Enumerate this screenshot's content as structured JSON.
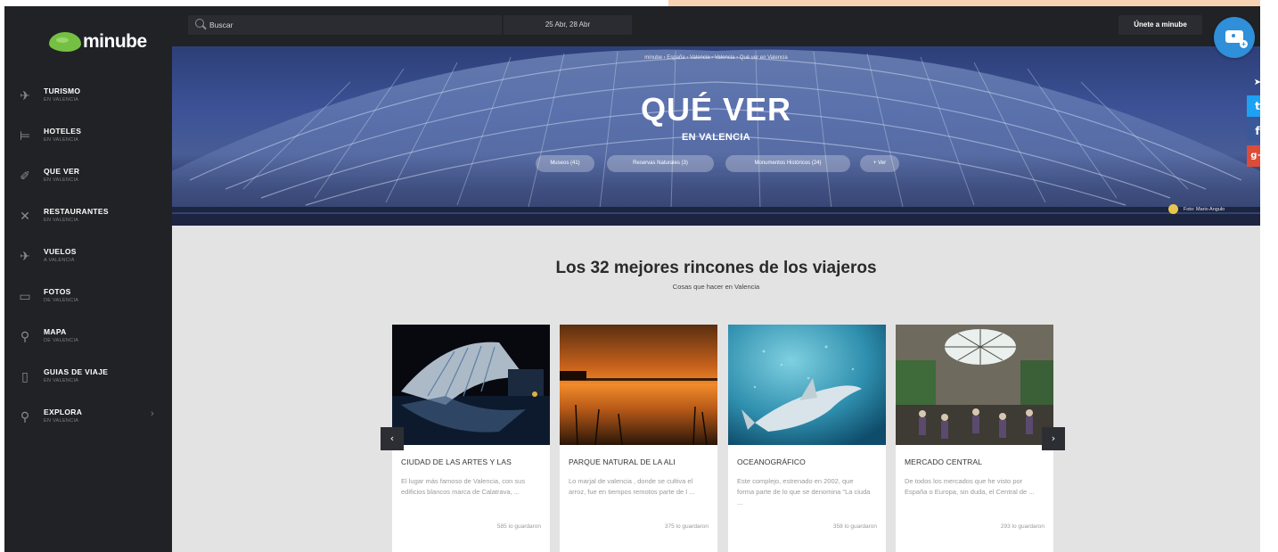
{
  "brand": {
    "logo_text": "minube"
  },
  "topbar": {
    "search_placeholder": "Buscar",
    "dates": "25 Abr, 28 Abr",
    "join_label": "Únete a minube"
  },
  "sidebar": {
    "items": [
      {
        "label": "TURISMO",
        "sub": "EN VALENCIA",
        "icon": "plane-icon"
      },
      {
        "label": "HOTELES",
        "sub": "EN VALENCIA",
        "icon": "bed-icon"
      },
      {
        "label": "QUE VER",
        "sub": "EN VALENCIA",
        "icon": "pin-icon"
      },
      {
        "label": "RESTAURANTES",
        "sub": "EN VALENCIA",
        "icon": "cutlery-icon"
      },
      {
        "label": "VUELOS",
        "sub": "A VALENCIA",
        "icon": "flight-icon"
      },
      {
        "label": "FOTOS",
        "sub": "DE VALENCIA",
        "icon": "photo-icon"
      },
      {
        "label": "MAPA",
        "sub": "DE VALENCIA",
        "icon": "map-pin-icon"
      },
      {
        "label": "GUIAS DE VIAJE",
        "sub": "EN VALENCIA",
        "icon": "guide-icon"
      },
      {
        "label": "EXPLORA",
        "sub": "EN VALENCIA",
        "icon": "search-icon"
      }
    ]
  },
  "hero": {
    "breadcrumb": "minube › España › Valencia › Valencia › Qué ver en Valencia",
    "title": "QUÉ VER",
    "subtitle": "EN VALENCIA",
    "chips": [
      "Museos (41)",
      "Reservas Naturales (3)",
      "Monumentos Históricos (24)",
      "+ Ver"
    ],
    "photo_credit": "Foto: Mario Angulo"
  },
  "main": {
    "title": "Los 32 mejores rincones de los viajeros",
    "subtitle": "Cosas que hacer en Valencia"
  },
  "cards": [
    {
      "title": "CIUDAD DE LAS ARTES Y LAS",
      "desc": "El lugar más famoso de Valencia, con sus edificios blancos marca de Calatrava, ...",
      "saved": "585 lo guardaron"
    },
    {
      "title": "PARQUE NATURAL DE LA ALI",
      "desc": "Lo marjal de valencia , donde se cultiva el arroz, fue en tiempos remotos parte de l ...",
      "saved": "375 lo guardaron"
    },
    {
      "title": "OCEANOGRÁFICO",
      "desc": "Este complejo, estrenado en 2002, que forma parte de lo que se denomina \"La ciuda ...",
      "saved": "358 lo guardaron"
    },
    {
      "title": "MERCADO CENTRAL",
      "desc": "De todos los mercados que he visto por España o Europa, sin duda, el Central de ...",
      "saved": "293 lo guardaron"
    }
  ],
  "colors": {
    "accent_green": "#75c043",
    "camera_blue": "#2f8fd8",
    "twitter": "#1da1f2",
    "facebook": "#3b5998",
    "gplus": "#dd4b39"
  }
}
